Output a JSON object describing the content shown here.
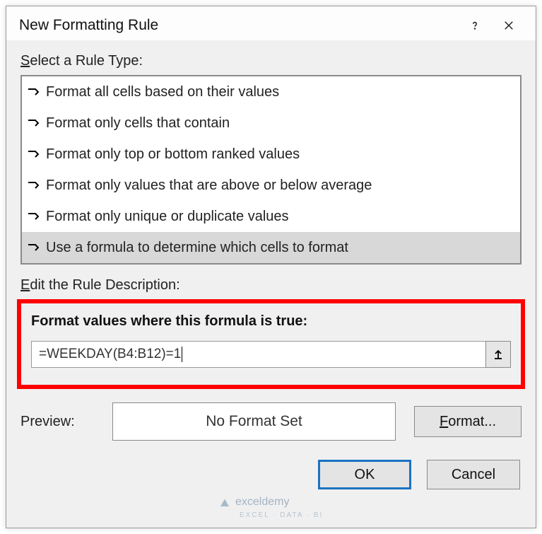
{
  "dialog": {
    "title": "New Formatting Rule"
  },
  "section": {
    "select_rule_label_pre": "S",
    "select_rule_label_post": "elect a Rule Type:",
    "edit_desc_label_pre": "E",
    "edit_desc_label_post": "dit the Rule Description:"
  },
  "rule_types": [
    {
      "label": "Format all cells based on their values"
    },
    {
      "label": "Format only cells that contain"
    },
    {
      "label": "Format only top or bottom ranked values"
    },
    {
      "label": "Format only values that are above or below average"
    },
    {
      "label": "Format only unique or duplicate values"
    },
    {
      "label": "Use a formula to determine which cells to format"
    }
  ],
  "formula": {
    "bold_label": "Format values where this formula is true:",
    "value": "=WEEKDAY(B4:B12)=1"
  },
  "preview": {
    "label": "Preview:",
    "text": "No Format Set",
    "format_btn_pre": "F",
    "format_btn_post": "ormat..."
  },
  "buttons": {
    "ok": "OK",
    "cancel": "Cancel"
  },
  "watermark": {
    "brand": "exceldemy",
    "tagline": "EXCEL · DATA · BI"
  }
}
